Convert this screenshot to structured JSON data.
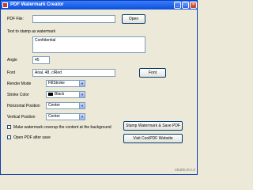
{
  "window": {
    "title": "PDF Watermark Creator",
    "minimize": "_",
    "maximize": "□",
    "close": "×"
  },
  "pdf_file": {
    "label": "PDF File:",
    "value": "",
    "open_button": "Open"
  },
  "stamp_text": {
    "label": "Text to stamp as watermark",
    "value": "Confidential"
  },
  "angle": {
    "label": "Angle",
    "value": "45"
  },
  "font": {
    "label": "Font",
    "value": "Arial, 48, clRed",
    "button": "Font"
  },
  "render_mode": {
    "label": "Render Mode",
    "value": "FillStroke"
  },
  "stroke_color": {
    "label": "Stroke Color",
    "value": "Black",
    "color": "#000000"
  },
  "horizontal_position": {
    "label": "Horizontal Position",
    "value": "Center"
  },
  "vertical_position": {
    "label": "Vertical Position",
    "value": "Center"
  },
  "options": {
    "coverup_label": "Make watermark coverup the content at the background",
    "open_after_label": "Open PDF after save"
  },
  "actions": {
    "stamp_button": "Stamp Watermark & Save PDF",
    "visit_button": "Visit CoolPDF Website"
  },
  "site_watermark": "studio.d.n.e"
}
